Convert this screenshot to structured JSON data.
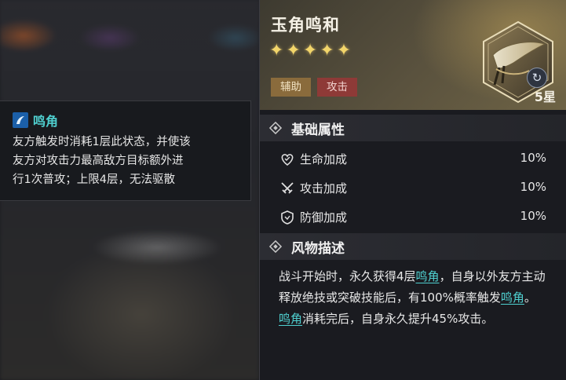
{
  "tooltip": {
    "title": "鸣角",
    "line1": "友方触发时消耗1层此状态，并使该",
    "line2": "友方对攻击力最高敌方目标额外进",
    "line3": "行1次普攻；上限4层，无法驱散",
    "icon": "horn-icon"
  },
  "item": {
    "name": "玉角鸣和",
    "stars": 5,
    "grade": "5星",
    "tags": [
      "辅助",
      "攻击"
    ],
    "image": "horn-artifact-image"
  },
  "basic": {
    "title": "基础属性",
    "stats": [
      {
        "label": "生命加成",
        "value": "10%",
        "icon": "heart-icon"
      },
      {
        "label": "攻击加成",
        "value": "10%",
        "icon": "crossed-swords-icon"
      },
      {
        "label": "防御加成",
        "value": "10%",
        "icon": "shield-icon"
      }
    ]
  },
  "lore": {
    "title": "风物描述",
    "seg1": "战斗开始时，永久获得4层",
    "kw1": "鸣角",
    "seg2": "，自身以外友方主动释放绝技或突破技能后，有100%概率触发",
    "kw2": "鸣角",
    "seg3": "。",
    "kw3": "鸣角",
    "seg4": "消耗完后，自身永久提升45%攻击。"
  },
  "colors": {
    "accent_keyword": "#4fd0d0",
    "star": "#f2d56a",
    "tag_support": "#8a6b3c",
    "tag_attack": "#8e3a37"
  }
}
